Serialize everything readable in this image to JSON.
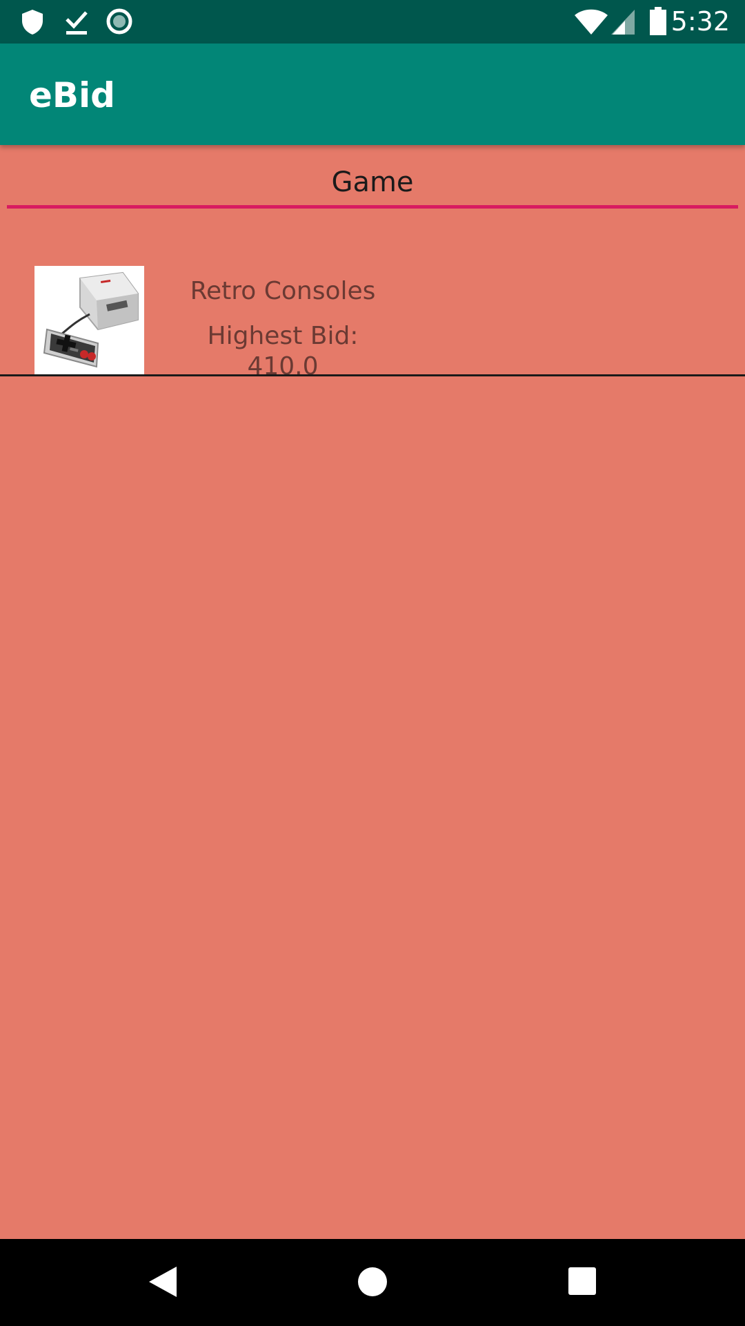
{
  "status_bar": {
    "time": "5:32",
    "left_icons": [
      "shield-icon",
      "download-done-icon",
      "record-icon"
    ],
    "right_icons": [
      "wifi-icon",
      "cell-signal-icon",
      "battery-icon"
    ]
  },
  "app_bar": {
    "title": "eBid",
    "color": "#028677"
  },
  "tabs": [
    {
      "label": "Game",
      "selected": true
    }
  ],
  "listings": [
    {
      "image_icon": "retro-console-thumbnail",
      "title": "Retro Consoles",
      "bid_text": "Highest Bid: 410.0"
    }
  ],
  "nav_bar": {
    "buttons": [
      "back-icon",
      "home-icon",
      "recents-icon"
    ]
  },
  "colors": {
    "background": "#E57A69",
    "status_bar": "#00574D",
    "tab_indicator": "#D81B60"
  }
}
